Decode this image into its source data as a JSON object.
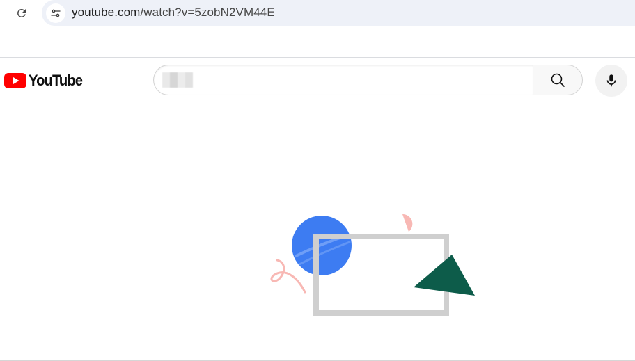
{
  "browser": {
    "url_host": "youtube.com",
    "url_path": "/watch?v=5zobN2VM44E"
  },
  "icons": {
    "reload": "reload-icon",
    "site_info": "tune-icon",
    "search": "search-icon",
    "mic": "mic-icon",
    "logo": "youtube-play-icon"
  },
  "youtube": {
    "logo_text": "YouTube",
    "search": {
      "value": "",
      "placeholder": ""
    }
  },
  "colors": {
    "brand_red": "#ff0000",
    "omnibox_bg": "#eef1f8",
    "illustration_blue": "#3d7cf2",
    "illustration_green": "#0d5c4a",
    "illustration_pink": "#f8b8b4",
    "illustration_frame": "#cfcfcf"
  }
}
